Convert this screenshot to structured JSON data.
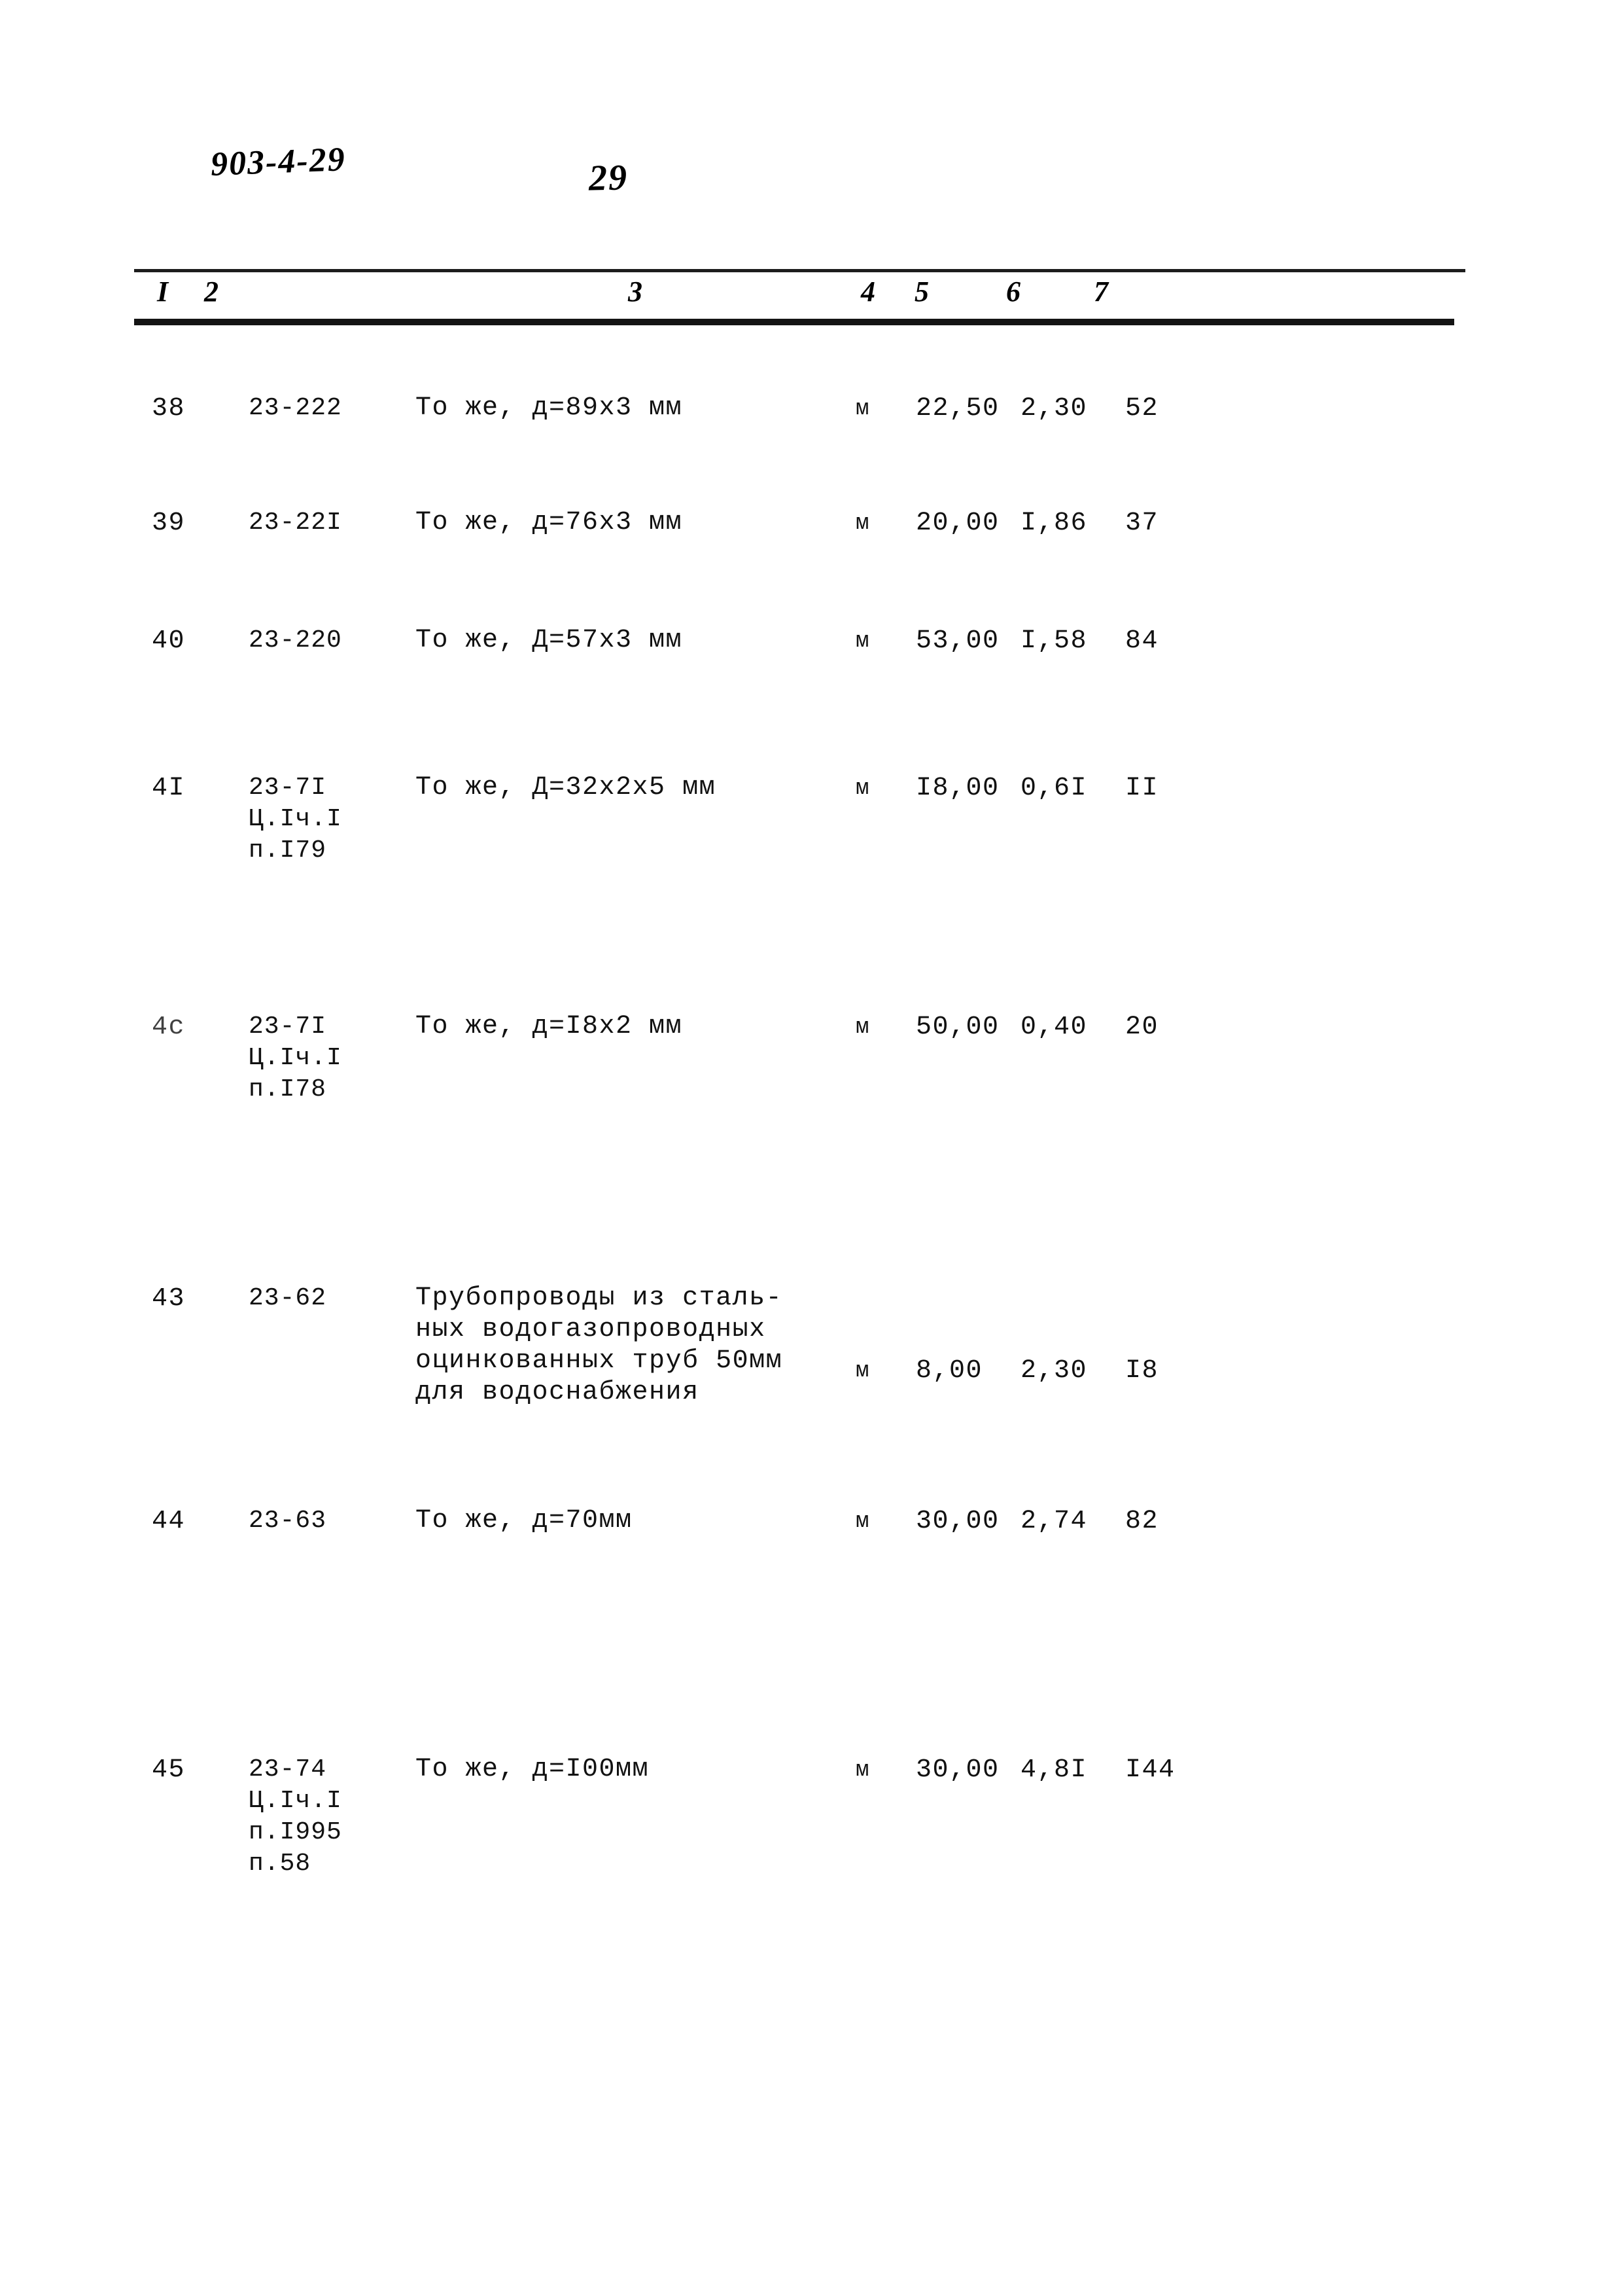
{
  "annotations": {
    "doc_code": "903-4-29",
    "page_number": "29"
  },
  "table": {
    "column_headers": [
      "I",
      "2",
      "3",
      "4",
      "5",
      "6",
      "7"
    ],
    "rows": [
      {
        "num": "38",
        "code": [
          "23-222"
        ],
        "desc": [
          "То же, д=89х3 мм"
        ],
        "unit": "м",
        "qty": "22,50",
        "w1": "2,30",
        "w2": "52"
      },
      {
        "num": "39",
        "code": [
          "23-22I"
        ],
        "desc": [
          "То же, д=76х3 мм"
        ],
        "unit": "м",
        "qty": "20,00",
        "w1": "I,86",
        "w2": "37"
      },
      {
        "num": "40",
        "code": [
          "23-220"
        ],
        "desc": [
          "То же, Д=57х3 мм"
        ],
        "unit": "м",
        "qty": "53,00",
        "w1": "I,58",
        "w2": "84"
      },
      {
        "num": "4I",
        "code": [
          "23-7I",
          "Ц.Iч.I",
          "п.I79"
        ],
        "desc": [
          "То же, Д=32х2х5 мм"
        ],
        "unit": "м",
        "qty": "I8,00",
        "w1": "0,6I",
        "w2": "II"
      },
      {
        "num": "4с",
        "code": [
          "23-7I",
          "Ц.Iч.I",
          "п.I78"
        ],
        "desc": [
          "То же, д=I8х2 мм"
        ],
        "unit": "м",
        "qty": "50,00",
        "w1": "0,40",
        "w2": "20"
      },
      {
        "num": "43",
        "code": [
          "23-62"
        ],
        "desc": [
          "Трубопроводы из сталь-",
          "ных водогазопроводных",
          "оцинкованных труб 50мм",
          "для водоснабжения"
        ],
        "unit": "м",
        "qty": "8,00",
        "w1": "2,30",
        "w2": "I8"
      },
      {
        "num": "44",
        "code": [
          "23-63"
        ],
        "desc": [
          "То же, д=70мм"
        ],
        "unit": "м",
        "qty": "30,00",
        "w1": "2,74",
        "w2": "82"
      },
      {
        "num": "45",
        "code": [
          "23-74",
          "Ц.Iч.I",
          "п.I995",
          "п.58"
        ],
        "desc": [
          "То же, д=I00мм"
        ],
        "unit": "м",
        "qty": "30,00",
        "w1": "4,8I",
        "w2": "I44"
      }
    ]
  }
}
